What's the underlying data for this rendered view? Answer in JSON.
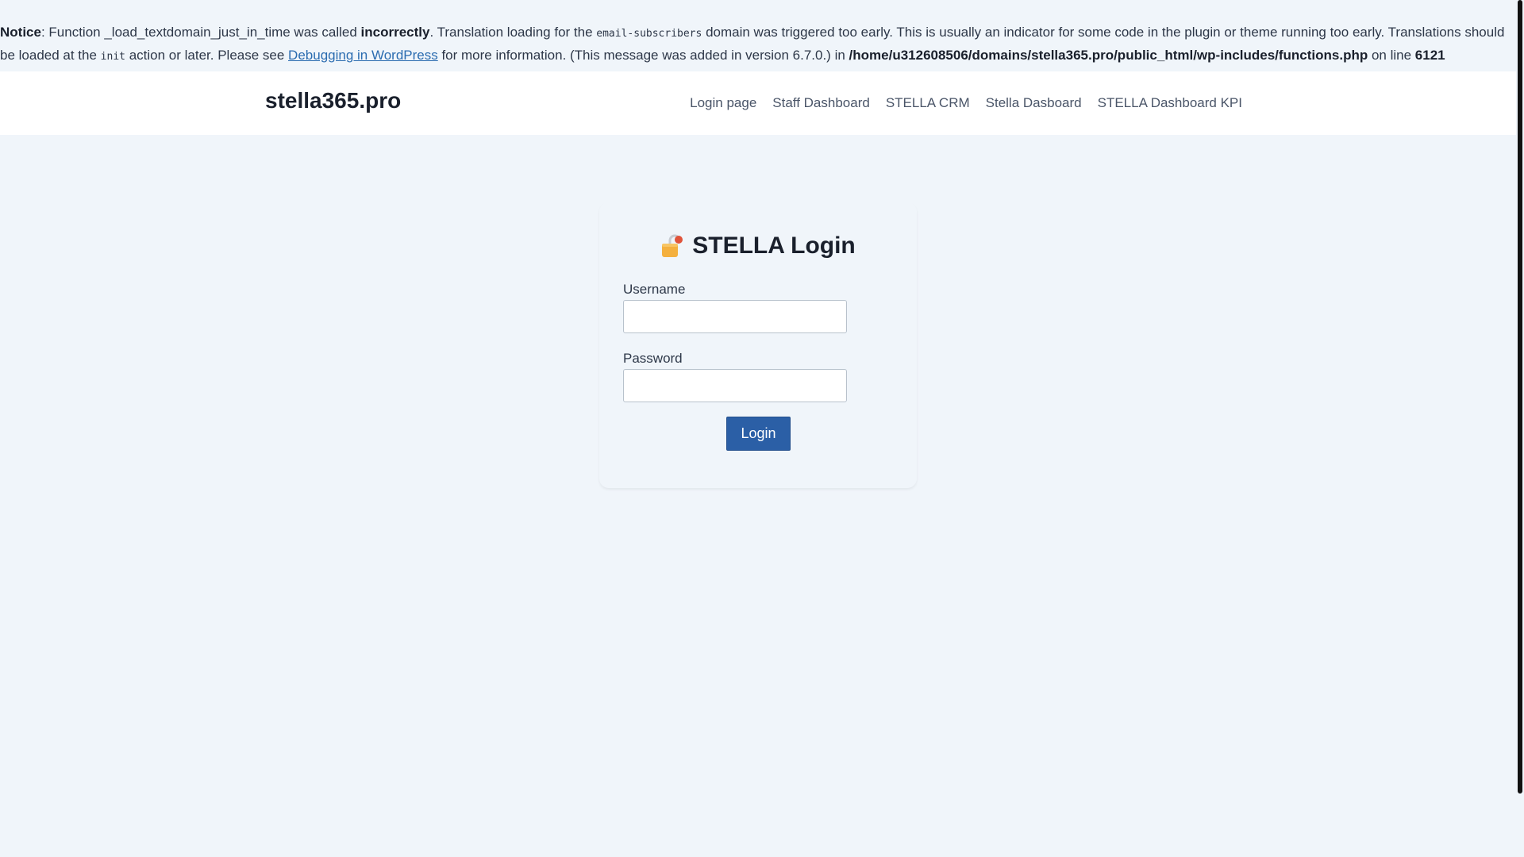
{
  "notice": {
    "label": "Notice",
    "part1": ": Function _load_textdomain_just_in_time was called ",
    "incorrectly": "incorrectly",
    "part2": ". Translation loading for the ",
    "domain_code": "email-subscribers",
    "part3": " domain was triggered too early. This is usually an indicator for some code in the plugin or theme running too early. Translations should be loaded at the ",
    "init_code": "init",
    "part4": " action or later. Please see ",
    "link_text": "Debugging in WordPress",
    "part5": " for more information. (This message was added in version 6.7.0.) in ",
    "file_path": "/home/u312608506/domains/stella365.pro/public_html/wp-includes/functions.php",
    "part6": " on line ",
    "line_number": "6121"
  },
  "header": {
    "site_title": "stella365.pro",
    "nav": [
      {
        "label": "Login page"
      },
      {
        "label": "Staff Dashboard"
      },
      {
        "label": "STELLA CRM"
      },
      {
        "label": "Stella Dasboard"
      },
      {
        "label": "STELLA Dashboard KPI"
      }
    ]
  },
  "login": {
    "title": "STELLA Login",
    "icon": "lock-icon",
    "username_label": "Username",
    "username_value": "",
    "password_label": "Password",
    "password_value": "",
    "button_label": "Login"
  },
  "colors": {
    "background": "#f0f5fa",
    "header_bg": "#ffffff",
    "button": "#2b5fa6",
    "link": "#2b6cb0"
  }
}
